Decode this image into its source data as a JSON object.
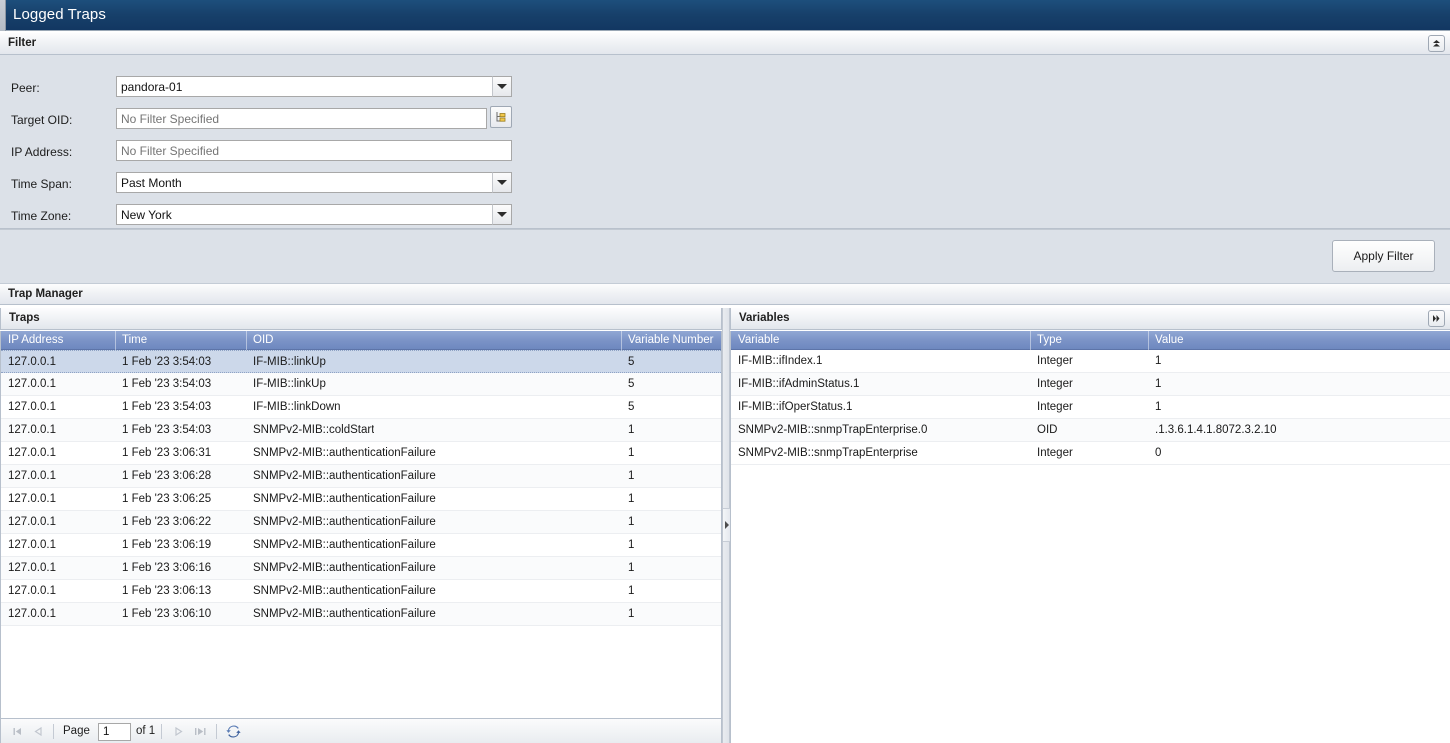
{
  "window": {
    "title": "Logged Traps"
  },
  "filter": {
    "section_label": "Filter",
    "collapse_icon": "chevron-double-up-icon",
    "fields": [
      {
        "label": "Peer:",
        "type": "combo",
        "value": "pandora-01",
        "placeholder": ""
      },
      {
        "label": "Target OID:",
        "type": "browse",
        "value": "",
        "placeholder": "No Filter Specified"
      },
      {
        "label": "IP Address:",
        "type": "text",
        "value": "",
        "placeholder": "No Filter Specified"
      },
      {
        "label": "Time Span:",
        "type": "combo",
        "value": "Past Month",
        "placeholder": ""
      },
      {
        "label": "Time Zone:",
        "type": "combo",
        "value": "New York",
        "placeholder": ""
      }
    ],
    "browse_icon": "oid-tree-browse-icon",
    "apply_label": "Apply Filter"
  },
  "trap_manager": {
    "section_label": "Trap Manager"
  },
  "traps": {
    "panel_label": "Traps",
    "columns": [
      "IP Address",
      "Time",
      "OID",
      "Variable Number"
    ],
    "rows": [
      {
        "ip": "127.0.0.1",
        "time": "1 Feb '23 3:54:03",
        "oid": "IF-MIB::linkUp",
        "var": "5",
        "selected": true
      },
      {
        "ip": "127.0.0.1",
        "time": "1 Feb '23 3:54:03",
        "oid": "IF-MIB::linkUp",
        "var": "5",
        "selected": false
      },
      {
        "ip": "127.0.0.1",
        "time": "1 Feb '23 3:54:03",
        "oid": "IF-MIB::linkDown",
        "var": "5",
        "selected": false
      },
      {
        "ip": "127.0.0.1",
        "time": "1 Feb '23 3:54:03",
        "oid": "SNMPv2-MIB::coldStart",
        "var": "1",
        "selected": false
      },
      {
        "ip": "127.0.0.1",
        "time": "1 Feb '23 3:06:31",
        "oid": "SNMPv2-MIB::authenticationFailure",
        "var": "1",
        "selected": false
      },
      {
        "ip": "127.0.0.1",
        "time": "1 Feb '23 3:06:28",
        "oid": "SNMPv2-MIB::authenticationFailure",
        "var": "1",
        "selected": false
      },
      {
        "ip": "127.0.0.1",
        "time": "1 Feb '23 3:06:25",
        "oid": "SNMPv2-MIB::authenticationFailure",
        "var": "1",
        "selected": false
      },
      {
        "ip": "127.0.0.1",
        "time": "1 Feb '23 3:06:22",
        "oid": "SNMPv2-MIB::authenticationFailure",
        "var": "1",
        "selected": false
      },
      {
        "ip": "127.0.0.1",
        "time": "1 Feb '23 3:06:19",
        "oid": "SNMPv2-MIB::authenticationFailure",
        "var": "1",
        "selected": false
      },
      {
        "ip": "127.0.0.1",
        "time": "1 Feb '23 3:06:16",
        "oid": "SNMPv2-MIB::authenticationFailure",
        "var": "1",
        "selected": false
      },
      {
        "ip": "127.0.0.1",
        "time": "1 Feb '23 3:06:13",
        "oid": "SNMPv2-MIB::authenticationFailure",
        "var": "1",
        "selected": false
      },
      {
        "ip": "127.0.0.1",
        "time": "1 Feb '23 3:06:10",
        "oid": "SNMPv2-MIB::authenticationFailure",
        "var": "1",
        "selected": false
      }
    ]
  },
  "variables": {
    "panel_label": "Variables",
    "expand_icon": "chevron-double-right-icon",
    "columns": [
      "Variable",
      "Type",
      "Value"
    ],
    "rows": [
      {
        "variable": "IF-MIB::ifIndex.1",
        "type": "Integer",
        "value": "1"
      },
      {
        "variable": "IF-MIB::ifAdminStatus.1",
        "type": "Integer",
        "value": "1"
      },
      {
        "variable": "IF-MIB::ifOperStatus.1",
        "type": "Integer",
        "value": "1"
      },
      {
        "variable": "SNMPv2-MIB::snmpTrapEnterprise.0",
        "type": "OID",
        "value": ".1.3.6.1.4.1.8072.3.2.10"
      },
      {
        "variable": "SNMPv2-MIB::snmpTrapEnterprise",
        "type": "Integer",
        "value": "0"
      }
    ]
  },
  "pager": {
    "first_icon": "page-first-icon",
    "prev_icon": "page-prev-icon",
    "page_label": "Page",
    "page_value": "1",
    "of_label": "of 1",
    "next_icon": "page-next-icon",
    "last_icon": "page-last-icon",
    "refresh_icon": "refresh-icon"
  },
  "colors": {
    "titlebar": "#17406a",
    "grid_header": "#7a92c6",
    "selected_row": "#ccd8ea",
    "panel_bg": "#dce1e8",
    "refresh_blue": "#4a6ea9"
  }
}
